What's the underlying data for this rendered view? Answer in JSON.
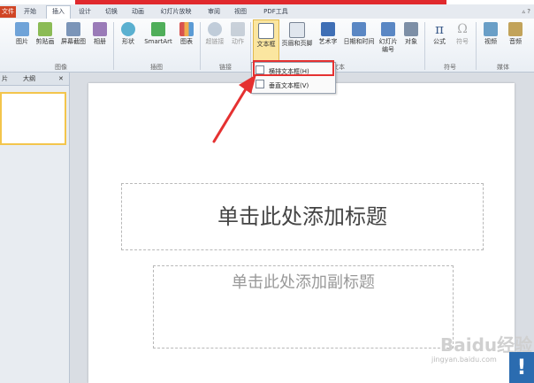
{
  "tabs": [
    {
      "label": "文件"
    },
    {
      "label": "开始"
    },
    {
      "label": "插入"
    },
    {
      "label": "设计"
    },
    {
      "label": "切换"
    },
    {
      "label": "动画"
    },
    {
      "label": "幻灯片放映"
    },
    {
      "label": "审阅"
    },
    {
      "label": "视图"
    },
    {
      "label": "PDF工具"
    }
  ],
  "active_tab": "插入",
  "ribbon": {
    "buttons": [
      {
        "label": "图片"
      },
      {
        "label": "剪贴画"
      },
      {
        "label": "屏幕截图"
      },
      {
        "label": "相册"
      },
      {
        "label": "形状"
      },
      {
        "label": "SmartArt"
      },
      {
        "label": "图表"
      },
      {
        "label": "超链接"
      },
      {
        "label": "动作"
      },
      {
        "label": "文本框"
      },
      {
        "label": "页眉和页脚"
      },
      {
        "label": "艺术字"
      },
      {
        "label": "日期和时间"
      },
      {
        "label": "幻灯片编号"
      },
      {
        "label": "对象"
      },
      {
        "label": "公式"
      },
      {
        "label": "符号"
      },
      {
        "label": "视频"
      },
      {
        "label": "音频"
      }
    ],
    "groups": {
      "images": "图像",
      "illustrations": "插图",
      "links": "链接",
      "text": "文本",
      "symbols": "符号",
      "media": "媒体"
    }
  },
  "dropdown": {
    "items": [
      {
        "label": "横排文本框(H)"
      },
      {
        "label": "垂直文本框(V)"
      }
    ]
  },
  "left_panel": {
    "tab1": "片",
    "tab2": "大纲",
    "close": "✕"
  },
  "slide": {
    "title_placeholder": "单击此处添加标题",
    "subtitle_placeholder": "单击此处添加副标题"
  },
  "watermark": {
    "brand": "Baidu经验",
    "url": "jingyan.baidu.com",
    "badge": "!"
  },
  "colors": {
    "accent_red": "#e53131",
    "file_tab": "#d04525",
    "highlight": "#fbe6a0"
  }
}
